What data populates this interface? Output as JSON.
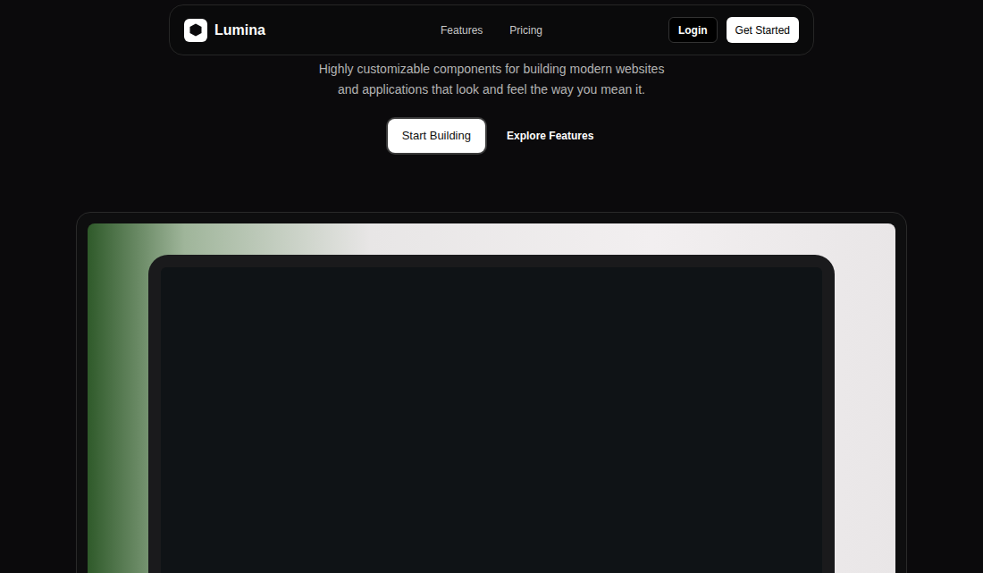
{
  "nav": {
    "brand": "Lumina",
    "links": [
      {
        "label": "Features"
      },
      {
        "label": "Pricing"
      }
    ],
    "login": "Login",
    "cta": "Get Started"
  },
  "hero": {
    "subtitle": [
      "Highly customizable components for building modern websites",
      "and applications that look and feel the way you mean it."
    ],
    "buttons": [
      {
        "label": "Start Building",
        "kind": "primary"
      },
      {
        "label": "Explore Features",
        "kind": "ghost"
      }
    ]
  }
}
